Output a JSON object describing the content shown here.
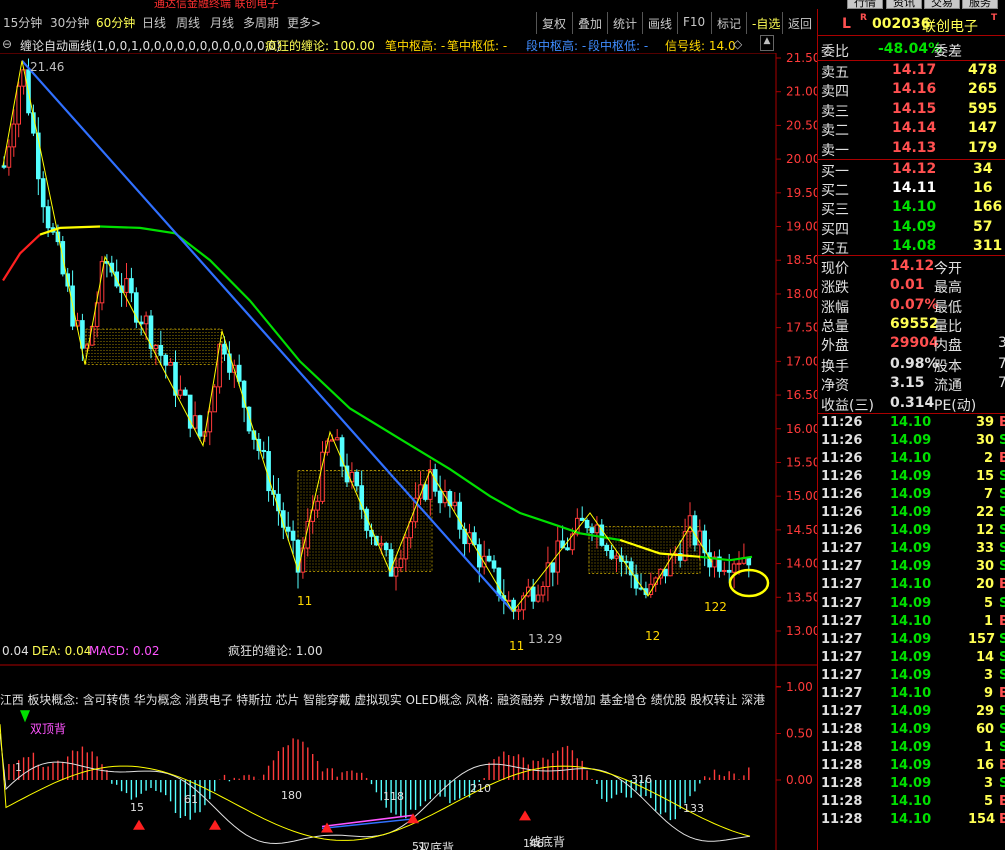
{
  "window_title": "通达信金融终端 联创电子",
  "top_buttons": [
    "行情",
    "资讯",
    "交易",
    "服务"
  ],
  "periods": [
    {
      "label": "15分钟",
      "selected": false
    },
    {
      "label": "30分钟",
      "selected": false
    },
    {
      "label": "60分钟",
      "selected": true
    },
    {
      "label": "日线",
      "selected": false
    },
    {
      "label": "周线",
      "selected": false
    },
    {
      "label": "月线",
      "selected": false
    },
    {
      "label": "多周期",
      "selected": false
    },
    {
      "label": "更多>",
      "selected": false
    }
  ],
  "toolbar": [
    {
      "label": "复权",
      "selected": false
    },
    {
      "label": "叠加",
      "selected": false
    },
    {
      "label": "统计",
      "selected": false
    },
    {
      "label": "画线",
      "selected": false
    },
    {
      "label": "F10",
      "selected": false
    },
    {
      "label": "标记",
      "selected": false
    },
    {
      "label": "-自选",
      "selected": true
    },
    {
      "label": "返回",
      "selected": false
    }
  ],
  "indicator_line": {
    "prefix": "⊖",
    "name": "缠论自动画线(1,0,0,1,0,0,0,0,0,0,0,0,0,0,0,0)",
    "crazy": "疯狂的缠论: 100.00",
    "bi_high": "笔中枢高: -",
    "bi_low": "笔中枢低: -",
    "duan_high": "段中枢高: -",
    "duan_low": "段中枢低: -",
    "signal": "信号线: 14.0",
    "signal_mark": "◇",
    "scroll_icon": "▲"
  },
  "price_axis": [
    "21.50",
    "21.00",
    "20.50",
    "20.00",
    "19.50",
    "19.00",
    "18.50",
    "18.00",
    "17.50",
    "17.00",
    "16.50",
    "16.00",
    "15.50",
    "15.00",
    "14.50",
    "14.00",
    "13.50",
    "13.00"
  ],
  "price_annotations": {
    "high": "21.46",
    "low": "13.29",
    "sub_labels": [
      "11",
      "11",
      "12",
      "122"
    ]
  },
  "macd_line": {
    "dif": "0.04",
    "dea": "DEA: 0.04",
    "macd": "MACD: 0.02",
    "crazy": "疯狂的缠论: 1.00"
  },
  "concepts_line": "江西  板块概念: 含可转债 华为概念 消费电子 特斯拉 芯片 智能穿戴 虚拟现实 OLED概念 风格: 融资融券 户数增加 基金增仓 绩优股 股权转让 深港",
  "macd_axis": [
    "1.00",
    "0.50",
    "0.00"
  ],
  "macd_annotations": {
    "top_signal": "双顶背",
    "double_bottom": "双底背",
    "line_bottom": "线底背",
    "numbers": [
      "1",
      "15",
      "61",
      "180",
      "118",
      "210",
      "316",
      "133",
      "146",
      "51"
    ]
  },
  "stock": {
    "market_flag": "L",
    "r_flag": "R",
    "code": "002036",
    "name": "联创电子",
    "t_flag": "T"
  },
  "order_book": {
    "weibi_label": "委比",
    "weibi": "-48.04%",
    "weicha_label": "委差",
    "asks": [
      {
        "label": "卖五",
        "price": "14.17",
        "vol": "478"
      },
      {
        "label": "卖四",
        "price": "14.16",
        "vol": "265"
      },
      {
        "label": "卖三",
        "price": "14.15",
        "vol": "595"
      },
      {
        "label": "卖二",
        "price": "14.14",
        "vol": "147"
      },
      {
        "label": "卖一",
        "price": "14.13",
        "vol": "179"
      }
    ],
    "bids": [
      {
        "label": "买一",
        "price": "14.12",
        "vol": "34"
      },
      {
        "label": "买二",
        "price": "14.11",
        "vol": "16"
      },
      {
        "label": "买三",
        "price": "14.10",
        "vol": "166"
      },
      {
        "label": "买四",
        "price": "14.09",
        "vol": "57"
      },
      {
        "label": "买五",
        "price": "14.08",
        "vol": "311"
      }
    ]
  },
  "stats": [
    {
      "l1": "现价",
      "v1": "14.12",
      "c1": "#ff5050",
      "l2": "今开",
      "v2": ""
    },
    {
      "l1": "涨跌",
      "v1": "0.01",
      "c1": "#ff5050",
      "l2": "最高",
      "v2": ""
    },
    {
      "l1": "涨幅",
      "v1": "0.07%",
      "c1": "#ff5050",
      "l2": "最低",
      "v2": ""
    },
    {
      "l1": "总量",
      "v1": "69552",
      "c1": "#ffff54",
      "l2": "量比",
      "v2": ""
    },
    {
      "l1": "外盘",
      "v1": "29904",
      "c1": "#ff5050",
      "l2": "内盘",
      "v2": "3"
    },
    {
      "l1": "换手",
      "v1": "0.98%",
      "c1": "#e0e0e0",
      "l2": "股本",
      "v2": "7"
    },
    {
      "l1": "净资",
      "v1": "3.15",
      "c1": "#e0e0e0",
      "l2": "流通",
      "v2": "7"
    },
    {
      "l1": "收益(三)",
      "v1": "0.314",
      "c1": "#e0e0e0",
      "l2": "PE(动)",
      "v2": ""
    }
  ],
  "ticks": [
    {
      "t": "11:26",
      "p": "14.10",
      "v": "39",
      "f": "B"
    },
    {
      "t": "11:26",
      "p": "14.09",
      "v": "30",
      "f": "S"
    },
    {
      "t": "11:26",
      "p": "14.10",
      "v": "2",
      "f": "B"
    },
    {
      "t": "11:26",
      "p": "14.09",
      "v": "15",
      "f": "S"
    },
    {
      "t": "11:26",
      "p": "14.09",
      "v": "7",
      "f": "S"
    },
    {
      "t": "11:26",
      "p": "14.09",
      "v": "22",
      "f": "S"
    },
    {
      "t": "11:26",
      "p": "14.09",
      "v": "12",
      "f": "S"
    },
    {
      "t": "11:27",
      "p": "14.09",
      "v": "33",
      "f": "S"
    },
    {
      "t": "11:27",
      "p": "14.09",
      "v": "30",
      "f": "S"
    },
    {
      "t": "11:27",
      "p": "14.10",
      "v": "20",
      "f": "B"
    },
    {
      "t": "11:27",
      "p": "14.09",
      "v": "5",
      "f": "S"
    },
    {
      "t": "11:27",
      "p": "14.10",
      "v": "1",
      "f": "B"
    },
    {
      "t": "11:27",
      "p": "14.09",
      "v": "157",
      "f": "S"
    },
    {
      "t": "11:27",
      "p": "14.09",
      "v": "14",
      "f": "S"
    },
    {
      "t": "11:27",
      "p": "14.09",
      "v": "3",
      "f": "S"
    },
    {
      "t": "11:27",
      "p": "14.10",
      "v": "9",
      "f": "B"
    },
    {
      "t": "11:27",
      "p": "14.09",
      "v": "29",
      "f": "S"
    },
    {
      "t": "11:28",
      "p": "14.09",
      "v": "60",
      "f": "S"
    },
    {
      "t": "11:28",
      "p": "14.09",
      "v": "1",
      "f": "S"
    },
    {
      "t": "11:28",
      "p": "14.09",
      "v": "16",
      "f": "B"
    },
    {
      "t": "11:28",
      "p": "14.09",
      "v": "3",
      "f": "S"
    },
    {
      "t": "11:28",
      "p": "14.10",
      "v": "5",
      "f": "B"
    },
    {
      "t": "11:28",
      "p": "14.10",
      "v": "154",
      "f": "B"
    }
  ],
  "colors": {
    "up": "#ff3a3a",
    "down": "#54ffff",
    "ma_red": "#ff2020",
    "ma_yellow": "#ffff00",
    "ma_green": "#00e000",
    "trend_blue": "#3070ff",
    "pivot": "#ffd700"
  }
}
